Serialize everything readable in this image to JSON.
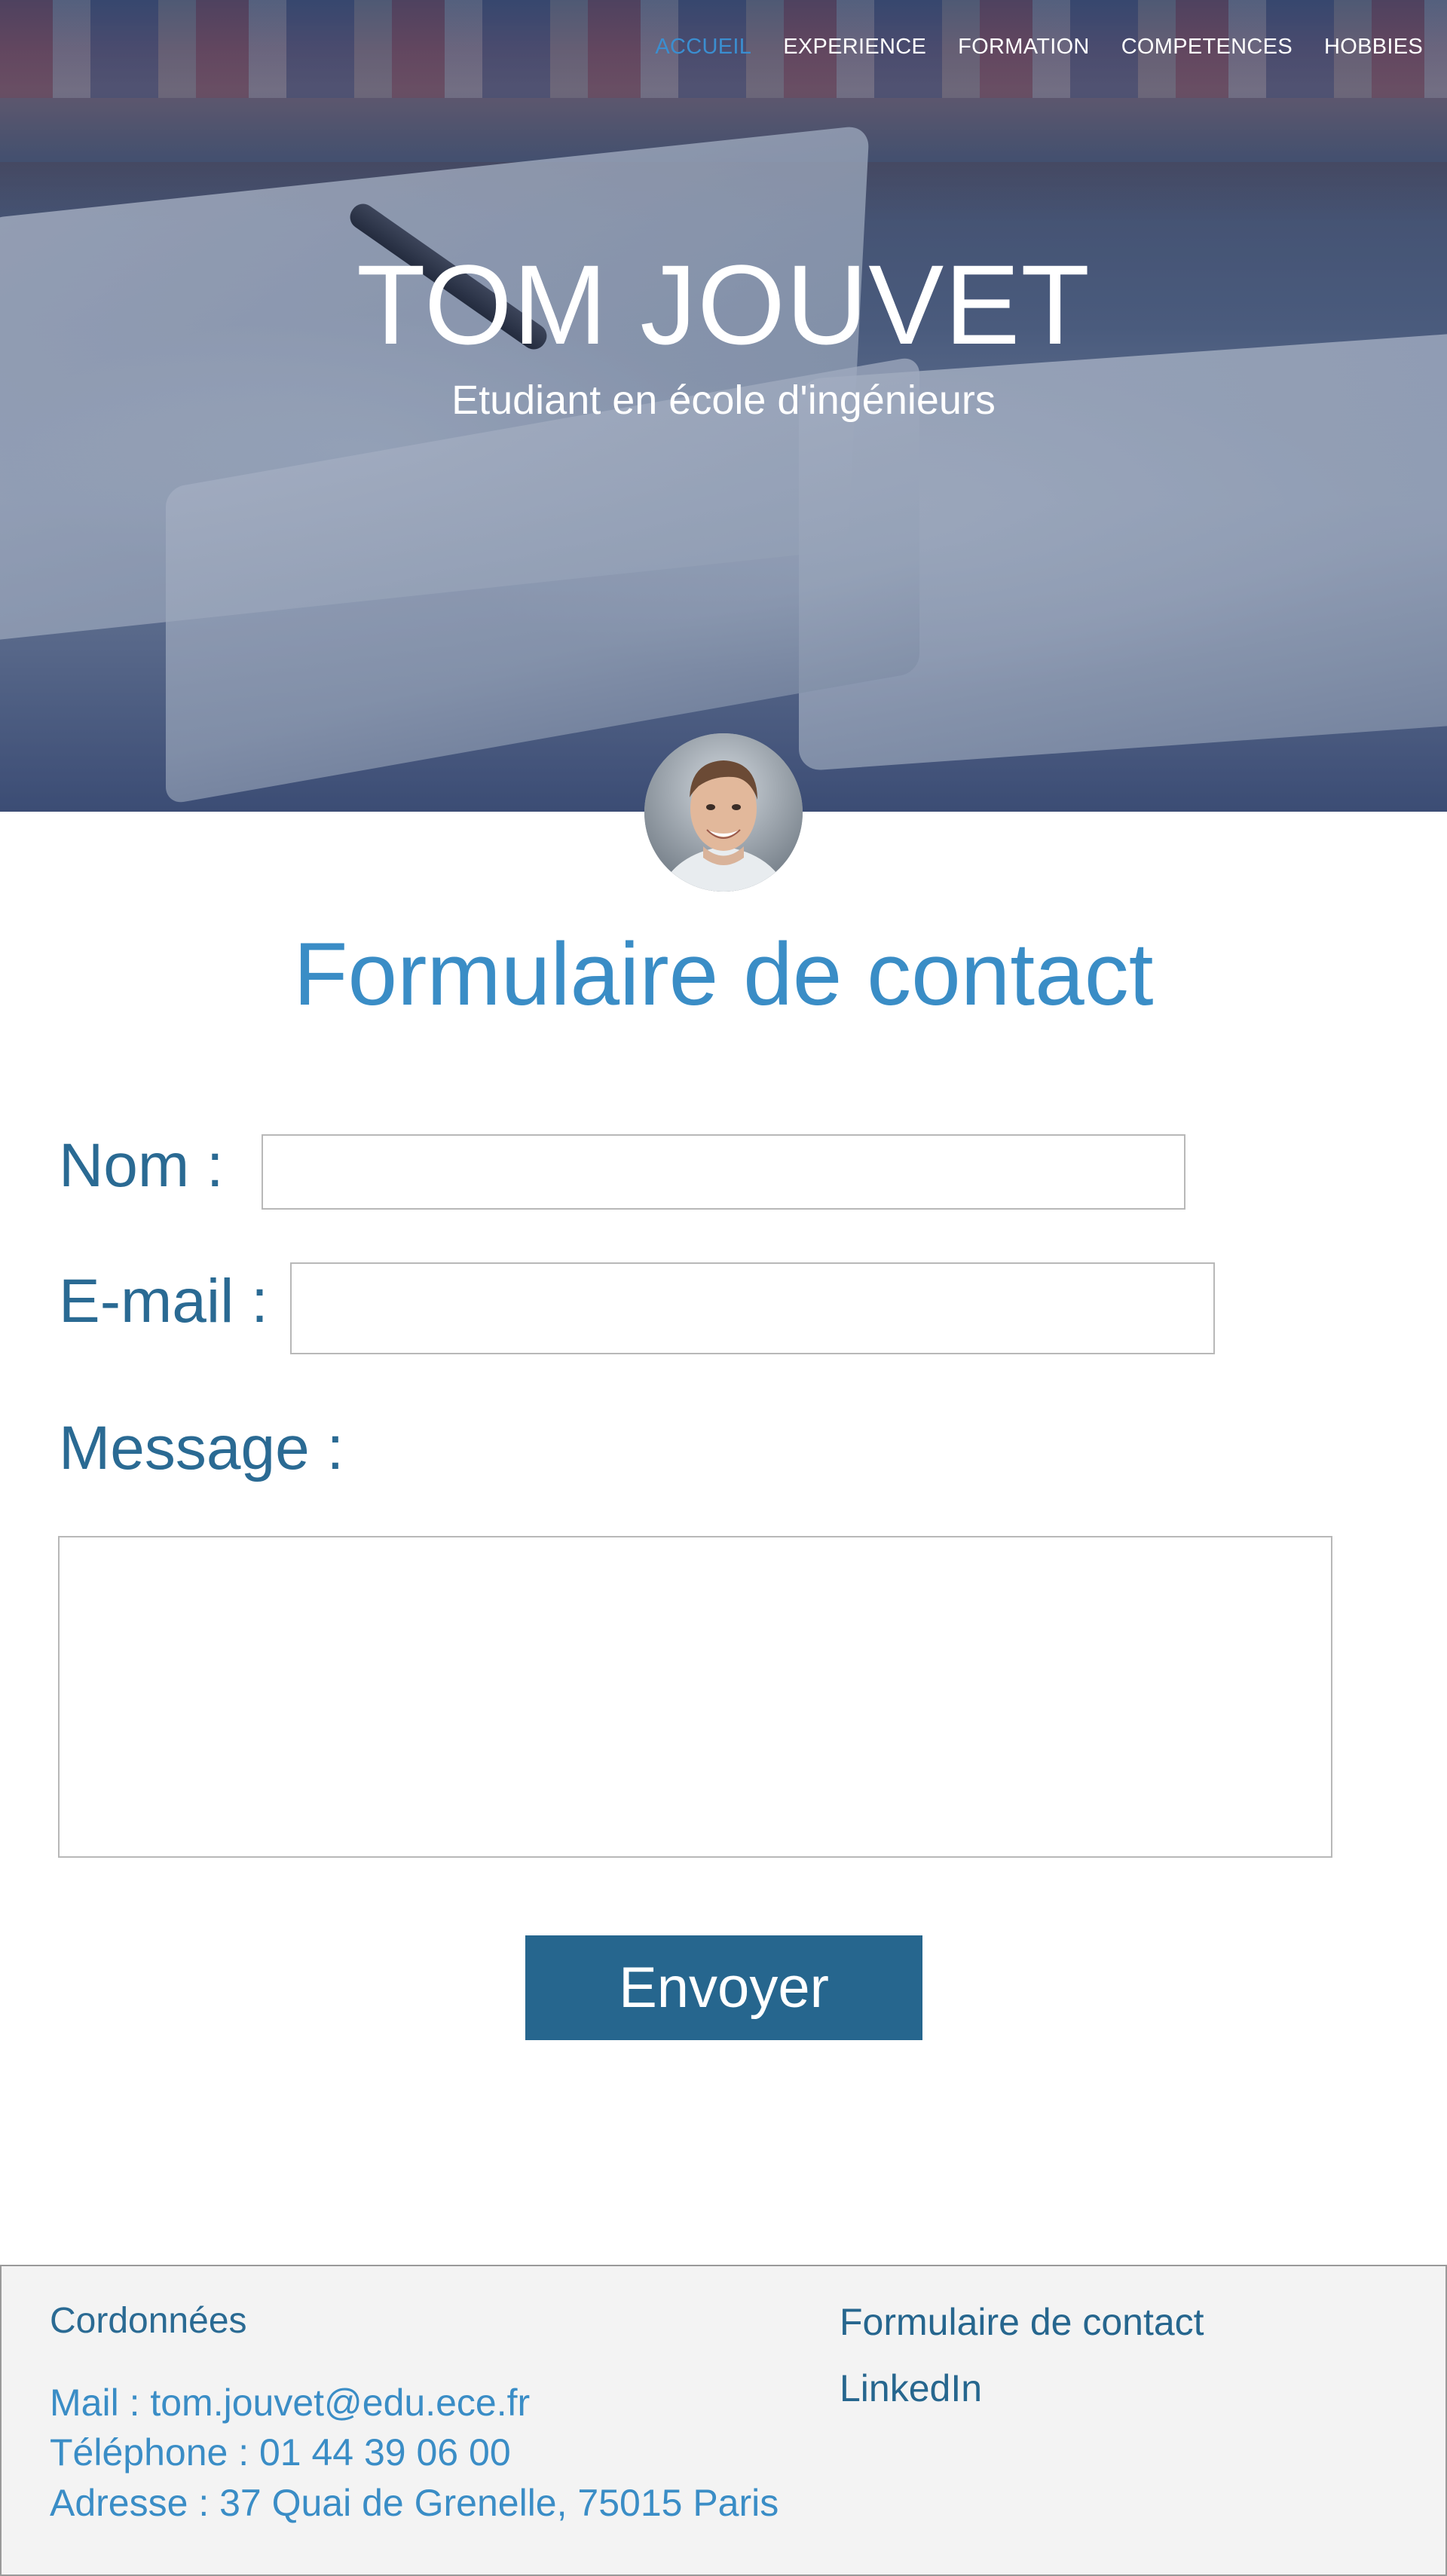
{
  "nav": {
    "items": [
      {
        "label": "ACCUEIL",
        "active": true
      },
      {
        "label": "EXPERIENCE",
        "active": false
      },
      {
        "label": "FORMATION",
        "active": false
      },
      {
        "label": "COMPETENCES",
        "active": false
      },
      {
        "label": "HOBBIES",
        "active": false
      }
    ]
  },
  "hero": {
    "name": "TOM JOUVET",
    "subtitle": "Etudiant en école d'ingénieurs"
  },
  "contact_form": {
    "title": "Formulaire de contact",
    "name_label": "Nom :",
    "name_value": "",
    "email_label": "E-mail :",
    "email_value": "",
    "message_label": "Message :",
    "message_value": "",
    "submit_label": "Envoyer"
  },
  "footer": {
    "heading": "Cordonnées",
    "mail": "Mail : tom.jouvet@edu.ece.fr",
    "phone": "Téléphone : 01 44 39 06 00",
    "address": "Adresse : 37 Quai de Grenelle, 75015 Paris",
    "links": [
      "Formulaire de contact",
      "LinkedIn"
    ]
  },
  "colors": {
    "accent": "#3a8dc6",
    "primary": "#26668e",
    "footer_bg": "#f3f3f3"
  }
}
